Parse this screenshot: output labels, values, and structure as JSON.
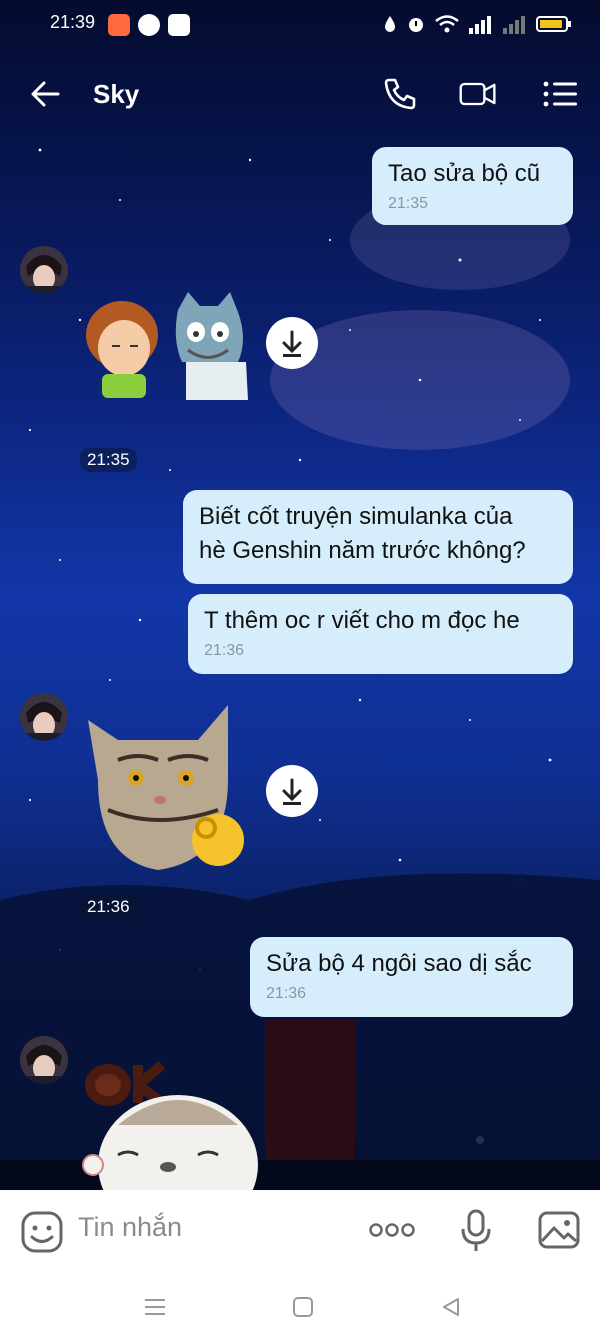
{
  "status_bar": {
    "time": "21:39"
  },
  "header": {
    "title": "Sky"
  },
  "messages": [
    {
      "text": "Tao sửa bộ cũ",
      "time": "21:35"
    },
    {
      "time": "21:35"
    },
    {
      "line1": "Biết cốt truyện simulanka của",
      "line2": "hè Genshin năm trước không?"
    },
    {
      "text": "T thêm oc r viết cho m đọc he",
      "time": "21:36"
    },
    {
      "time": "21:36"
    },
    {
      "text": "Sửa bộ 4 ngôi sao dị sắc",
      "time": "21:36"
    }
  ],
  "composer": {
    "placeholder": "Tin nhắn"
  },
  "colors": {
    "bubble": "#d6eefb",
    "time_gray": "#8a97a3"
  },
  "icons": [
    "back-arrow-icon",
    "phone-icon",
    "video-call-icon",
    "menu-list-icon",
    "download-icon",
    "emoji-icon",
    "more-dots-icon",
    "mic-icon",
    "image-icon"
  ]
}
